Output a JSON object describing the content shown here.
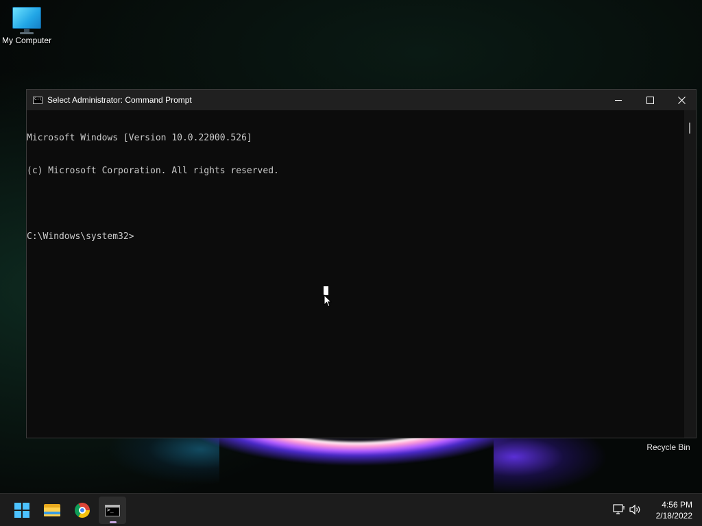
{
  "desktop": {
    "icons": [
      {
        "label": "My Computer",
        "icon": "monitor-icon"
      },
      {
        "label": "Recycle Bin",
        "icon": "recycle-bin-icon"
      }
    ]
  },
  "window": {
    "title": "Select Administrator: Command Prompt",
    "icon": "command-prompt-icon",
    "controls": {
      "minimize": "minimize-icon",
      "maximize": "maximize-icon",
      "close": "close-icon"
    },
    "console_lines": [
      "Microsoft Windows [Version 10.0.22000.526]",
      "(c) Microsoft Corporation. All rights reserved.",
      "",
      "C:\\Windows\\system32>"
    ]
  },
  "taskbar": {
    "apps": [
      {
        "name": "Start",
        "icon": "windows-logo-icon"
      },
      {
        "name": "File Explorer",
        "icon": "folder-icon"
      },
      {
        "name": "Google Chrome",
        "icon": "chrome-icon"
      },
      {
        "name": "Command Prompt",
        "icon": "command-prompt-icon",
        "active": true
      }
    ],
    "tray": {
      "network_icon": "network-icon",
      "volume_icon": "volume-icon"
    },
    "time": "4:56 PM",
    "date": "2/18/2022"
  },
  "colors": {
    "accent": "#4cc2ff",
    "console_bg": "#0c0c0c",
    "console_text": "#cccccc",
    "titlebar": "#202020",
    "taskbar": "#1c1c1c"
  }
}
